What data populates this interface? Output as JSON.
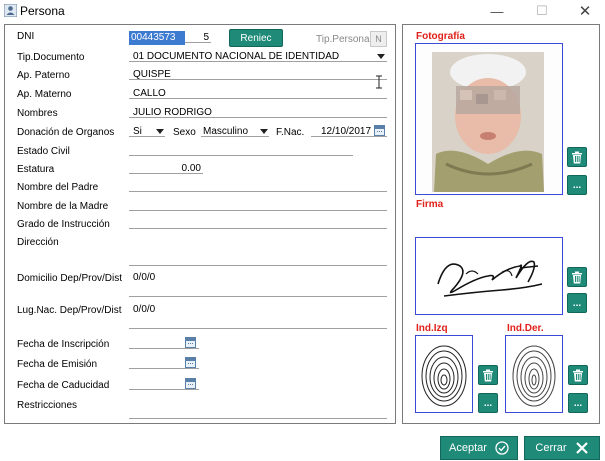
{
  "window": {
    "title": "Persona",
    "minimize_glyph": "—",
    "maximize_glyph": "☐",
    "close_glyph": "✕"
  },
  "form": {
    "dni": {
      "label": "DNI",
      "value": "00443573",
      "check_digit": "5"
    },
    "reniec_button": "Reniec",
    "tip_persona": {
      "label": "Tip.Persona",
      "value": "N"
    },
    "tip_documento": {
      "label": "Tip.Documento",
      "value": "01 DOCUMENTO NACIONAL DE IDENTIDAD"
    },
    "ap_paterno": {
      "label": "Ap. Paterno",
      "value": "QUISPE"
    },
    "ap_materno": {
      "label": "Ap. Materno",
      "value": "CALLO"
    },
    "nombres": {
      "label": "Nombres",
      "value": "JULIO RODRIGO"
    },
    "donacion": {
      "label": "Donación de Organos",
      "value": "Si"
    },
    "sexo": {
      "label": "Sexo",
      "value": "Masculino"
    },
    "fnac": {
      "label": "F.Nac.",
      "value": "12/10/2017"
    },
    "estado_civil": {
      "label": "Estado Civil",
      "value": ""
    },
    "estatura": {
      "label": "Estatura",
      "value": "0.00"
    },
    "nombre_padre": {
      "label": "Nombre del Padre",
      "value": ""
    },
    "nombre_madre": {
      "label": "Nombre de la Madre",
      "value": ""
    },
    "grado_instruccion": {
      "label": "Grado de Instrucción",
      "value": ""
    },
    "direccion": {
      "label": "Dirección",
      "value": ""
    },
    "domicilio": {
      "label": "Domicilio Dep/Prov/Dist",
      "value": "0/0/0"
    },
    "lugnac": {
      "label": "Lug.Nac. Dep/Prov/Dist",
      "value": "0/0/0"
    },
    "fecha_inscripcion": {
      "label": "Fecha de Inscripción",
      "value": ""
    },
    "fecha_emision": {
      "label": "Fecha de Emisión",
      "value": ""
    },
    "fecha_caducidad": {
      "label": "Fecha de Caducidad",
      "value": ""
    },
    "restricciones": {
      "label": "Restricciones",
      "value": ""
    }
  },
  "media": {
    "fotografia_label": "Fotografía",
    "firma_label": "Firma",
    "ind_izq_label": "Ind.Izq",
    "ind_der_label": "Ind.Der.",
    "more_glyph": "..."
  },
  "footer": {
    "aceptar": "Aceptar",
    "cerrar": "Cerrar"
  },
  "colors": {
    "accent": "#1f8a78",
    "frame_border": "#3c4ad8",
    "section_label": "#e0201a"
  }
}
